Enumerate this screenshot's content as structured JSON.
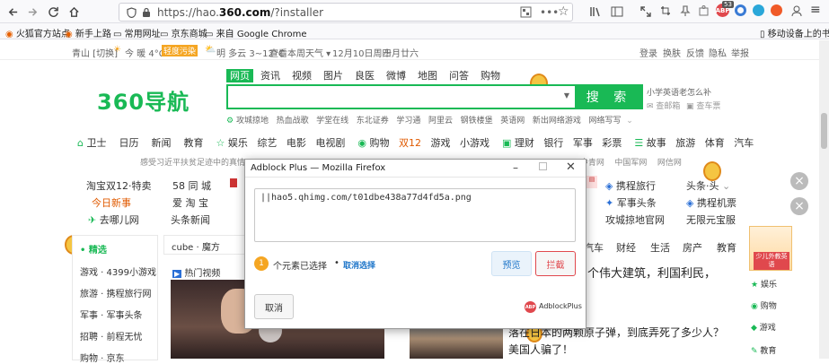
{
  "browser": {
    "url": "https://hao.360.com/?installer",
    "url_prefix": "https://hao.",
    "url_domain": "360.com",
    "url_suffix": "/?installer",
    "badge_count": "53",
    "bookmarks": [
      "火狐官方站点",
      "新手上路",
      "常用网址",
      "京东商城",
      "来自 Google Chrome"
    ],
    "mobile_bookmarks": "移动设备上的书签"
  },
  "topstrip": {
    "location": "青山 [切换]",
    "weather_today": "今 暖 4°C",
    "air_quality": "轻度污染",
    "weather_tomorrow": "明 多云 3~12°C",
    "forecast_link": "查看本周天气 ▾",
    "date": "12月10日周四",
    "lunar": "十月廿六",
    "links": [
      "登录",
      "换肤",
      "反馈",
      "隐私",
      "举报"
    ]
  },
  "logo": "360导航",
  "search": {
    "tabs": [
      "网页",
      "资讯",
      "视频",
      "图片",
      "良医",
      "微博",
      "地图",
      "问答",
      "购物"
    ],
    "button": "搜 索",
    "suggestion": "小学英语老怎么补",
    "hot_links": [
      "攻城掠地",
      "热血战歌",
      "学堂在线",
      "东北证券",
      "学习通",
      "阿里云",
      "钢铁楼堡",
      "英语网",
      "新出网络游戏",
      "网络写写"
    ],
    "extra1": "查邮箱",
    "extra2": "查车票"
  },
  "catnav": [
    "卫士",
    "日历",
    "新闻",
    "教育",
    "娱乐",
    "综艺",
    "电影",
    "电视剧",
    "购物",
    "双12",
    "游戏",
    "小游戏",
    "理财",
    "银行",
    "军事",
    "彩票",
    "故事",
    "旅游",
    "体育",
    "汽车"
  ],
  "notice": "感受习近平扶贫足迹中的真情",
  "notice_right": [
    "中青网",
    "中国军网",
    "网信网"
  ],
  "sites": {
    "col1": [
      "淘宝双12·特卖",
      "今日新事",
      "去哪儿网"
    ],
    "col2": [
      "58 同 城",
      "爱 淘 宝",
      "头条新闻"
    ],
    "col3": [
      "携程旅行",
      "军事头条",
      "攻城掠地官网"
    ],
    "col4": [
      "头条·头",
      "携程机票",
      "无限元宝服"
    ]
  },
  "left_panel": {
    "title": "精选",
    "items": [
      "游戏 · 4399小游戏",
      "旅游 · 携程旅行网",
      "军事 · 军事头条",
      "招聘 · 前程无忧",
      "购物 · 京东"
    ]
  },
  "content": {
    "tab_label": "cube · 魔方",
    "video_label": "热门视频",
    "right_tabs": [
      "汽车",
      "财经",
      "生活",
      "房产",
      "教育"
    ],
    "headline1": "个伟大建筑，利国利民，",
    "headline2": "落在日本的两颗原子弹，到底弄死了多少人？",
    "headline3": "美国人骗了！"
  },
  "right_side": {
    "ad": "少儿外教英语",
    "items": [
      "娱乐",
      "购物",
      "游戏",
      "教育"
    ]
  },
  "dialog": {
    "title": "Adblock Plus — Mozilla Firefox",
    "filter_text": "||hao5.qhimg.com/t01dbe438a77d4fd5a.png",
    "count_badge": "1",
    "count_text": "个元素已选择",
    "cancel_select": "取消选择",
    "preview_button": "预览",
    "block_button": "拦截",
    "cancel_button": "取消",
    "brand": "AdblockPlus",
    "brand_icon": "ABP"
  },
  "colors": {
    "brand_green": "#19b955",
    "block_red": "#e0484d",
    "preview_blue": "#eaf3fb"
  }
}
